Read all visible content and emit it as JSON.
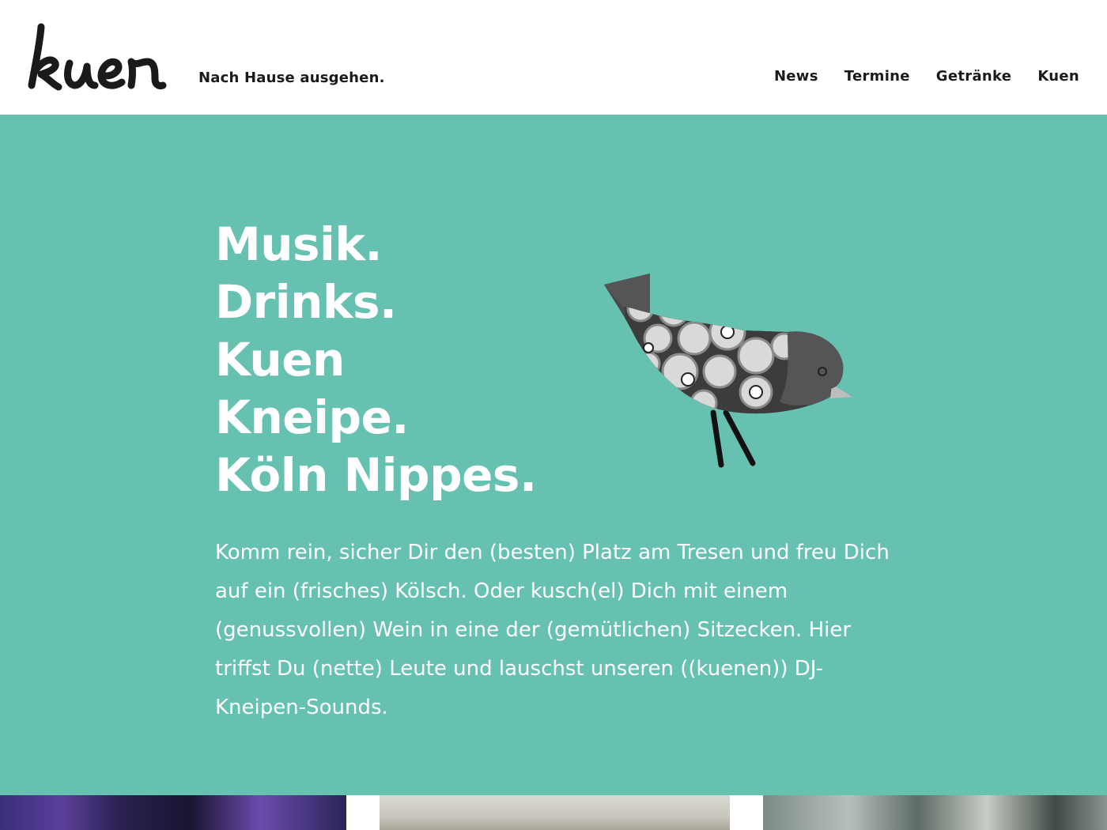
{
  "site": {
    "logo_text": "kuen",
    "tagline": "Nach Hause ausgehen."
  },
  "nav": {
    "items": [
      {
        "label": "News"
      },
      {
        "label": "Termine"
      },
      {
        "label": "Getränke"
      },
      {
        "label": "Kuen"
      }
    ]
  },
  "hero": {
    "headline": [
      "Musik.",
      "Drinks.",
      "Kuen",
      "Kneipe.",
      "Köln Nippes."
    ],
    "intro": "Komm rein, sicher Dir den (besten) Platz am Tresen und freu Dich auf ein (frisches) Kölsch. Oder kusch(el) Dich mit einem (genussvollen) Wein in eine der (gemütlichen) Sitzecken. Hier triffst Du (nette) Leute und lauschst unseren ((kuenen)) DJ-Kneipen-Sounds.",
    "illustration": "bird-illustration"
  },
  "colors": {
    "hero_background": "#66c1b1",
    "text_dark": "#1a1a1a",
    "text_light": "#ffffff"
  },
  "gallery": {
    "thumbnails": [
      "photo-thumbnail-1",
      "photo-thumbnail-2",
      "photo-thumbnail-3"
    ]
  }
}
